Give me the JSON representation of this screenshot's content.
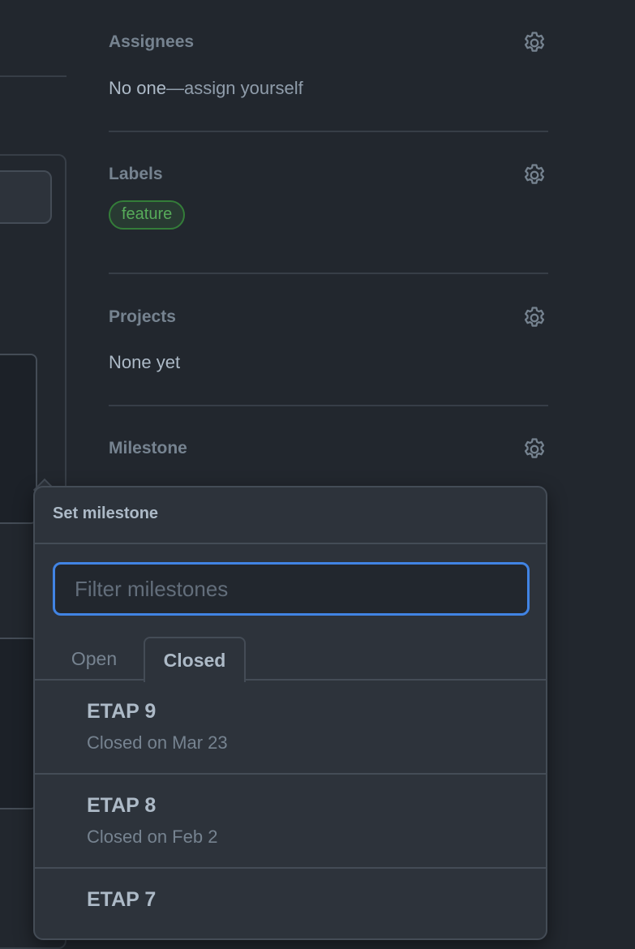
{
  "sidebar": {
    "assignees": {
      "title": "Assignees",
      "value_strong": "No one",
      "value_link": "—assign yourself"
    },
    "labels": {
      "title": "Labels",
      "items": [
        "feature"
      ]
    },
    "projects": {
      "title": "Projects",
      "value": "None yet"
    },
    "milestone": {
      "title": "Milestone"
    }
  },
  "milestone_dropdown": {
    "title": "Set milestone",
    "filter_placeholder": "Filter milestones",
    "filter_value": "",
    "tabs": [
      {
        "label": "Open",
        "active": false
      },
      {
        "label": "Closed",
        "active": true
      }
    ],
    "items": [
      {
        "name": "ETAP 9",
        "status": "Closed on Mar 23"
      },
      {
        "name": "ETAP 8",
        "status": "Closed on Feb 2"
      },
      {
        "name": "ETAP 7",
        "status": ""
      }
    ]
  },
  "colors": {
    "background": "#22272e",
    "accent_focus": "#4184e4",
    "label_feature": "#57ab5a"
  },
  "icons": {
    "section_settings": "gear-icon"
  }
}
